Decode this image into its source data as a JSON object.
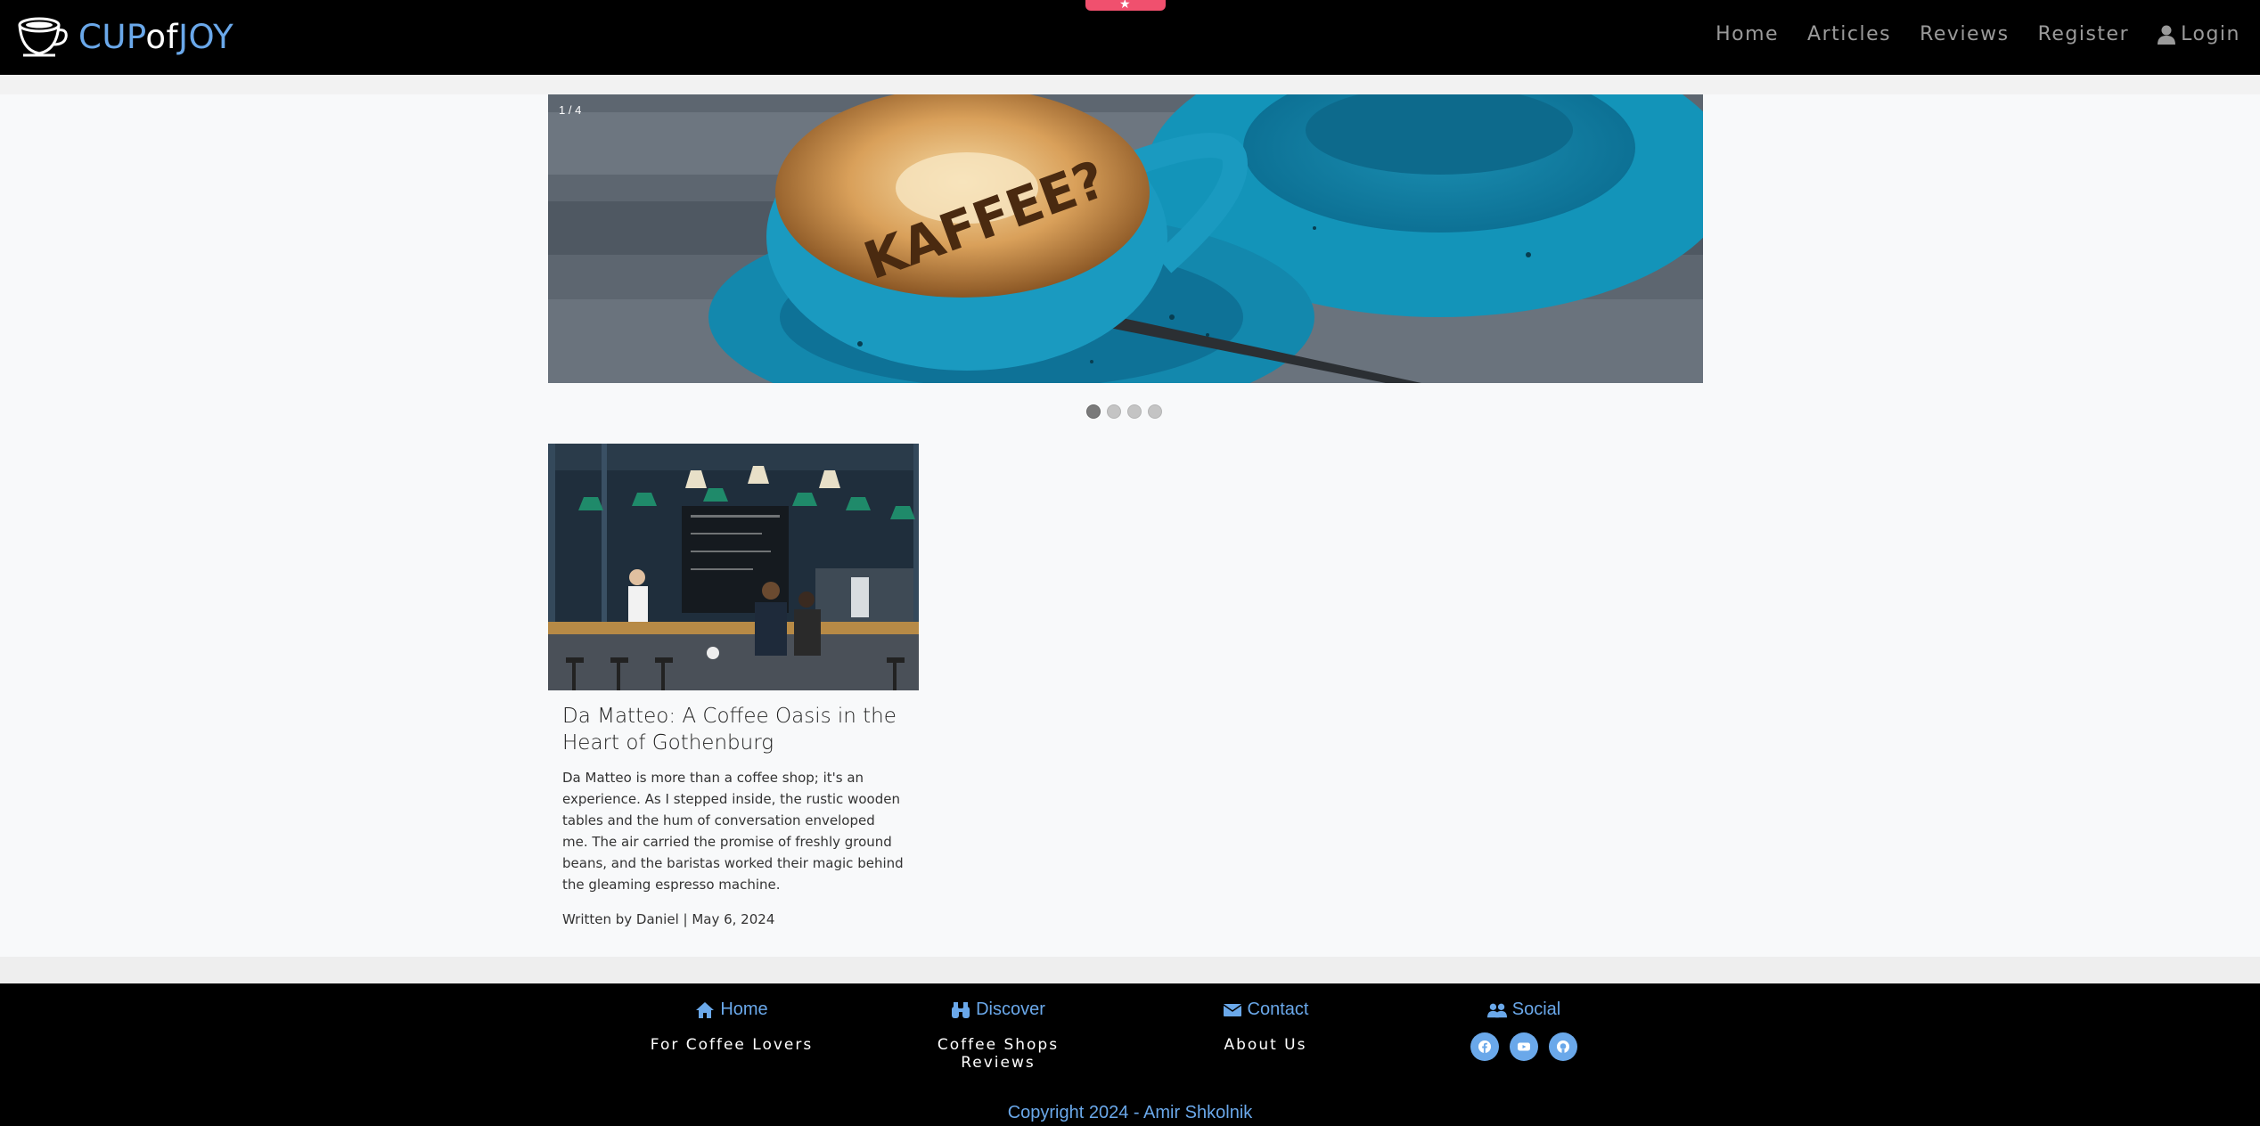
{
  "brand": {
    "part1": "CUP",
    "part2": "of",
    "part3": "JOY"
  },
  "nav": {
    "home": "Home",
    "articles": "Articles",
    "reviews": "Reviews",
    "register": "Register",
    "login": "Login"
  },
  "carousel": {
    "slide_indicator": "1 / 4",
    "cup_text": "KAFFEE?",
    "slide_count": 4,
    "active_slide": 1
  },
  "article": {
    "title": "Da Matteo: A Coffee Oasis in the Heart of Gothenburg",
    "excerpt": "Da Matteo is more than a coffee shop; it's an experience. As I stepped inside, the rustic wooden tables and the hum of conversation enveloped me. The air carried the promise of freshly ground beans, and the baristas worked their magic behind the gleaming espresso machine.",
    "meta": "Written by Daniel | May 6, 2024"
  },
  "footer": {
    "home": {
      "heading": "Home",
      "link": "For Coffee Lovers",
      "icon": "home-icon"
    },
    "discover": {
      "heading": "Discover",
      "link": "Coffee Shops Reviews",
      "icon": "binoculars-icon"
    },
    "contact": {
      "heading": "Contact",
      "link": "About Us",
      "icon": "envelope-icon"
    },
    "social": {
      "heading": "Social",
      "icon": "users-icon",
      "links": [
        "facebook-icon",
        "youtube-icon",
        "github-icon"
      ]
    },
    "copyright": "Copyright 2024 - Amir Shkolnik"
  },
  "colors": {
    "accent": "#6aa8ea",
    "navbar_bg": "#000000",
    "nav_text": "#9a9a9a",
    "top_tab": "#f0506e"
  }
}
